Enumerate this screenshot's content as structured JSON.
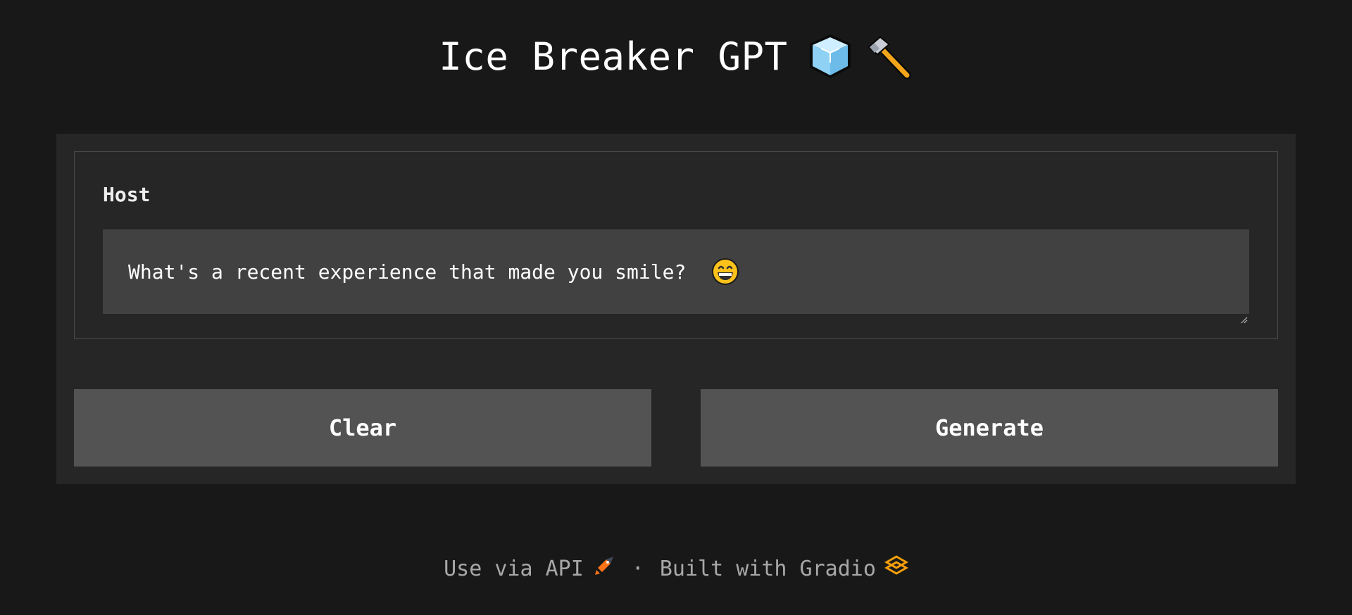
{
  "header": {
    "title": "Ice Breaker GPT",
    "icons": [
      "ice-cube-icon",
      "hammer-icon"
    ]
  },
  "form": {
    "host_label": "Host",
    "host_value": "What's a recent experience that made you smile?",
    "host_emoji": "grinning-face-icon"
  },
  "buttons": {
    "clear_label": "Clear",
    "generate_label": "Generate"
  },
  "footer": {
    "api_label": "Use via API",
    "separator": "·",
    "built_label": "Built with Gradio",
    "api_icon": "rocket-icon",
    "gradio_icon": "gradio-logo-icon"
  },
  "colors": {
    "background": "#181818",
    "panel": "#262626",
    "textbox": "#414141",
    "button": "#535353",
    "accent": "#f97316"
  }
}
